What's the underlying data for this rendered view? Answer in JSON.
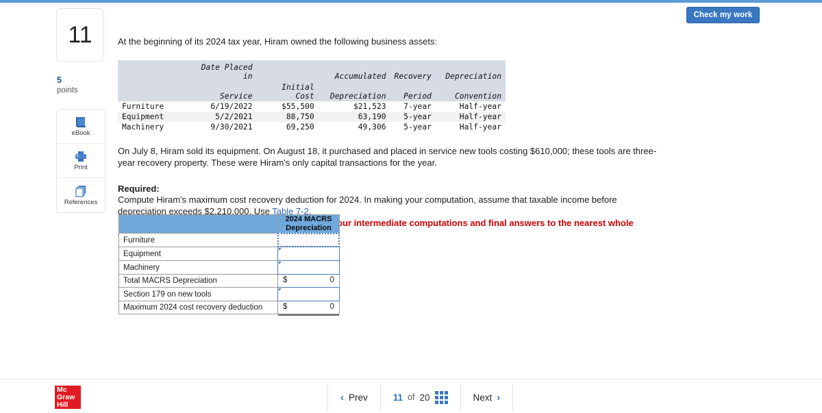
{
  "check_button": {
    "label": "Check my work"
  },
  "sidebar": {
    "question_number": "11",
    "points_value": "5",
    "points_label": "points",
    "tools": [
      {
        "label": "eBook",
        "icon": "book-icon"
      },
      {
        "label": "Print",
        "icon": "printer-icon"
      },
      {
        "label": "References",
        "icon": "references-icon"
      }
    ]
  },
  "question": {
    "intro": "At the beginning of its 2024 tax year, Hiram owned the following business assets:",
    "paragraph": "On July 8, Hiram sold its equipment. On August 18, it purchased and placed in service new tools costing $610,000; these tools are three-year recovery property. These were Hiram's only capital transactions for the year.",
    "required_heading": "Required:",
    "required_text_before_link": "Compute Hiram's maximum cost recovery deduction for 2024. In making your computation, assume that taxable income before depreciation exceeds $2,210,000. Use ",
    "required_link": "Table 7-2",
    "required_text_after_link": ".",
    "note": "Note: Enter all amounts as positive values. Round your intermediate computations and final answers to the nearest whole dollar amount."
  },
  "asset_table": {
    "headers_line1": [
      "",
      "Date Placed in",
      "",
      "Accumulated",
      "Recovery",
      "Depreciation"
    ],
    "headers_line2": [
      "",
      "Service",
      "Initial Cost",
      "Depreciation",
      "Period",
      "Convention"
    ],
    "rows": [
      {
        "name": "Furniture",
        "date": "6/19/2022",
        "cost": "$55,500",
        "accumulated": "$21,523",
        "period": "7-year",
        "convention": "Half-year"
      },
      {
        "name": "Equipment",
        "date": "5/2/2021",
        "cost": "88,750",
        "accumulated": "63,190",
        "period": "5-year",
        "convention": "Half-year"
      },
      {
        "name": "Machinery",
        "date": "9/30/2021",
        "cost": "69,250",
        "accumulated": "49,306",
        "period": "5-year",
        "convention": "Half-year"
      }
    ]
  },
  "answer_table": {
    "column_header": "2024 MACRS Depreciation",
    "column_header_line1": "2024 MACRS",
    "column_header_line2": "Depreciation",
    "rows": [
      {
        "label": "Furniture",
        "type": "input",
        "value": "",
        "focused": true
      },
      {
        "label": "Equipment",
        "type": "input",
        "value": "",
        "focused": false
      },
      {
        "label": "Machinery",
        "type": "input",
        "value": "",
        "focused": false
      },
      {
        "label": "Total MACRS Depreciation",
        "type": "computed",
        "currency": "$",
        "value": "0"
      },
      {
        "label": "Section 179 on new tools",
        "type": "input",
        "value": "",
        "focused": false
      },
      {
        "label": "Maximum 2024 cost recovery deduction",
        "type": "computed",
        "currency": "$",
        "value": "0"
      }
    ]
  },
  "footer": {
    "logo_line1": "Mc",
    "logo_line2": "Graw",
    "logo_line3": "Hill",
    "prev_label": "Prev",
    "next_label": "Next",
    "page_current": "11",
    "page_of": "of",
    "page_total": "20"
  },
  "colors": {
    "accent_blue": "#3a77c2",
    "header_blue": "#6fa8dc",
    "note_red": "#cc0000",
    "logo_red": "#e01b24",
    "table_header_gray": "#d6dbe5"
  }
}
